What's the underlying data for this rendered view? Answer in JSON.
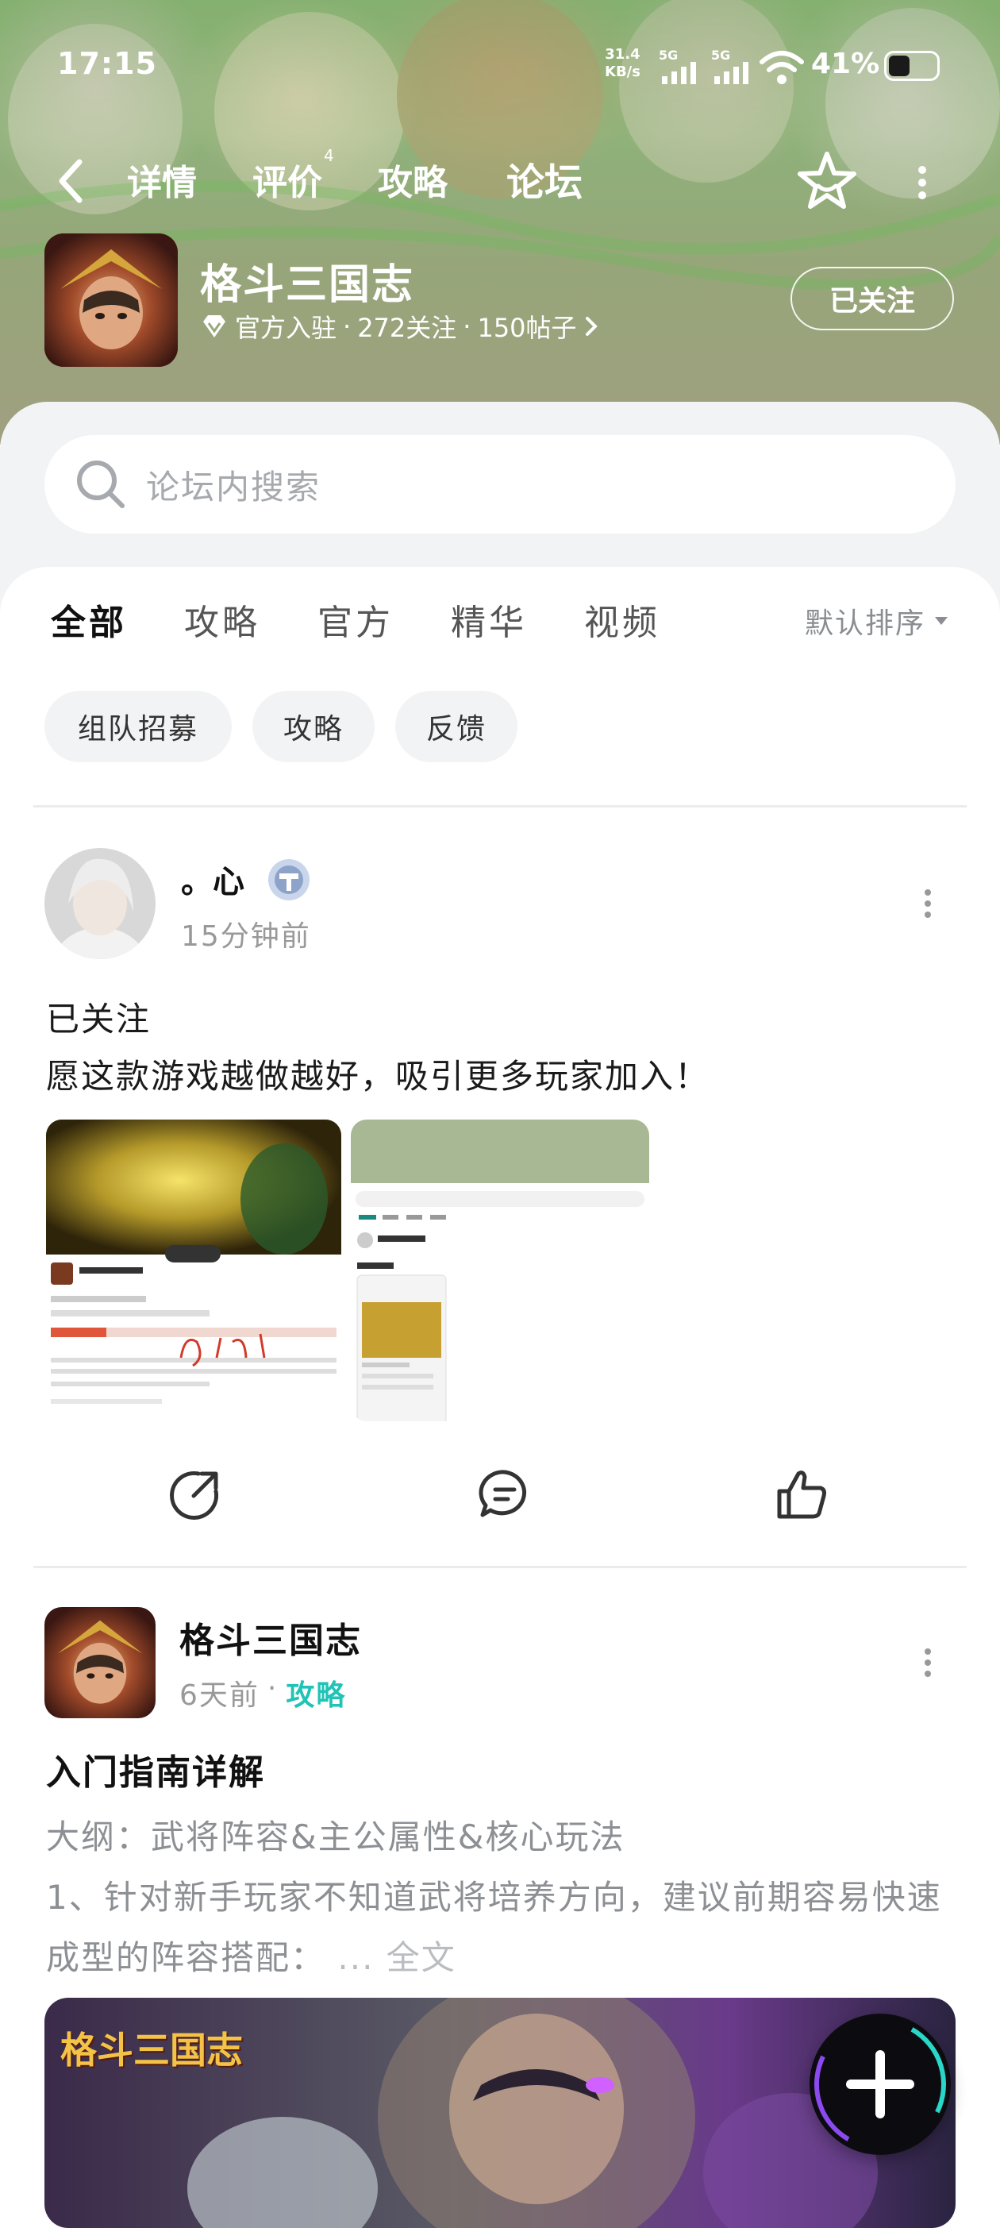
{
  "status_bar": {
    "time": "17:15",
    "net_speed_value": "31.4",
    "net_speed_unit": "KB/s",
    "signal_1": "5G",
    "signal_2": "5G",
    "battery_percent": "41%",
    "battery_level": 0.41
  },
  "nav": {
    "tabs": [
      {
        "label": "详情"
      },
      {
        "label": "评价",
        "badge": "4"
      },
      {
        "label": "攻略"
      },
      {
        "label": "论坛"
      }
    ],
    "active_tab": "论坛"
  },
  "game": {
    "title": "格斗三国志",
    "badge": "官方入驻",
    "follows": "272关注",
    "posts": "150帖子",
    "separator": "·",
    "follow_button": "已关注"
  },
  "search": {
    "placeholder": "论坛内搜索"
  },
  "filter_tabs": {
    "items": [
      "全部",
      "攻略",
      "官方",
      "精华",
      "视频"
    ],
    "active": "全部",
    "sort_label": "默认排序"
  },
  "chips": [
    "组队招募",
    "攻略",
    "反馈"
  ],
  "posts": [
    {
      "user": "。心",
      "time": "15分钟前",
      "lines": [
        "已关注",
        "愿这款游戏越做越好，吸引更多玩家加入！"
      ],
      "images": [
        "screenshot-1",
        "screenshot-2"
      ]
    },
    {
      "user": "格斗三国志",
      "time": "6天前",
      "separator": "·",
      "tag": "攻略",
      "title": "入门指南详解",
      "body_line1": "大纲：武将阵容&主公属性&核心玩法",
      "body_line2": "1、针对新手玩家不知道武将培养方向，建议前期容易快速成型的阵容搭配：",
      "ellipsis": "...",
      "read_more": "全文",
      "image_logo_text": "格斗三国志"
    }
  ],
  "theme": {
    "accent": "#29d6c7",
    "link": "#21c3b6"
  }
}
